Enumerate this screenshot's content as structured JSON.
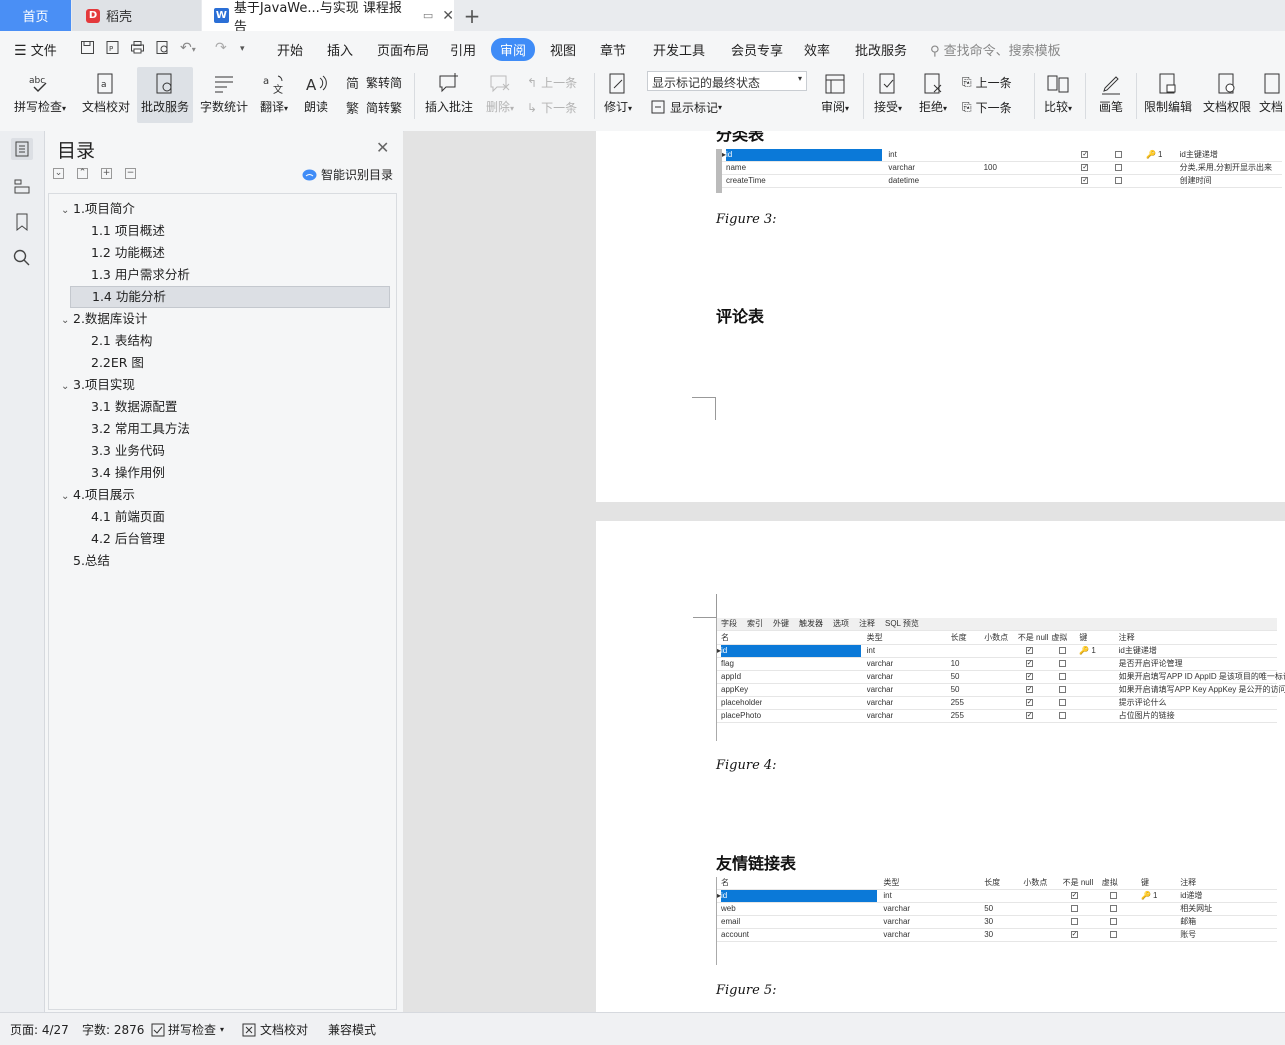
{
  "tabs": {
    "home": "首页",
    "daoke": "稻壳",
    "doc": "基于JavaWe...与实现 课程报告"
  },
  "menu": {
    "file": "文件",
    "items": [
      "开始",
      "插入",
      "页面布局",
      "引用",
      "审阅",
      "视图",
      "章节",
      "开发工具",
      "会员专享",
      "效率",
      "批改服务"
    ],
    "active": "审阅",
    "search_placeholder": "查找命令、搜索模板"
  },
  "ribbon": {
    "spell_check": "拼写检查",
    "doc_proof": "文档校对",
    "correction_service": "批改服务",
    "word_count": "字数统计",
    "translate": "翻译",
    "read_aloud": "朗读",
    "trad_to_simp": "繁转简",
    "simp_to_trad": "简转繁",
    "insert_comment": "插入批注",
    "delete": "删除",
    "prev_comment": "上一条",
    "next_comment": "下一条",
    "track_changes": "修订",
    "markup_state": "显示标记的最终状态",
    "show_markup": "显示标记",
    "review": "审阅",
    "accept": "接受",
    "reject": "拒绝",
    "prev_change": "上一条",
    "next_change": "下一条",
    "compare": "比较",
    "pen": "画笔",
    "restrict_edit": "限制编辑",
    "doc_permission": "文档权限",
    "doc_more": "文档"
  },
  "toc": {
    "title": "目录",
    "smart": "智能识别目录",
    "items": [
      {
        "label": "1.项目简介",
        "level": 1,
        "expanded": true
      },
      {
        "label": "1.1 项目概述",
        "level": 2
      },
      {
        "label": "1.2 功能概述",
        "level": 2
      },
      {
        "label": "1.3 用户需求分析",
        "level": 2
      },
      {
        "label": "1.4 功能分析",
        "level": 2,
        "selected": true
      },
      {
        "label": "2.数据库设计",
        "level": 1,
        "expanded": true
      },
      {
        "label": "2.1 表结构",
        "level": 2
      },
      {
        "label": "2.2ER 图",
        "level": 2
      },
      {
        "label": "3.项目实现",
        "level": 1,
        "expanded": true
      },
      {
        "label": "3.1 数据源配置",
        "level": 2
      },
      {
        "label": "3.2 常用工具方法",
        "level": 2
      },
      {
        "label": "3.3 业务代码",
        "level": 2
      },
      {
        "label": "3.4 操作用例",
        "level": 2
      },
      {
        "label": "4.项目展示",
        "level": 1,
        "expanded": true
      },
      {
        "label": "4.1 前端页面",
        "level": 2
      },
      {
        "label": "4.2 后台管理",
        "level": 2
      },
      {
        "label": "5.总结",
        "level": 1
      }
    ]
  },
  "document": {
    "heading_category": "分类表",
    "figure3": "Figure 3:",
    "heading_comment": "评论表",
    "figure4": "Figure 4:",
    "heading_links": "友情链接表",
    "figure5": "Figure 5:",
    "table_category": [
      {
        "name": "id",
        "type": "int",
        "len": "",
        "notnull": true,
        "virtual": false,
        "key": "1",
        "comment": "id主键递增"
      },
      {
        "name": "name",
        "type": "varchar",
        "len": "100",
        "notnull": true,
        "virtual": false,
        "key": "",
        "comment": "分类,采用,分割开显示出来"
      },
      {
        "name": "createTime",
        "type": "datetime",
        "len": "",
        "notnull": true,
        "virtual": false,
        "key": "",
        "comment": "创建时间"
      }
    ],
    "comment_tabs": [
      "字段",
      "索引",
      "外键",
      "触发器",
      "选项",
      "注释",
      "SQL 预览"
    ],
    "comment_headers": [
      "名",
      "类型",
      "长度",
      "小数点",
      "不是 null",
      "虚拟",
      "键",
      "注释"
    ],
    "table_comment": [
      {
        "name": "id",
        "type": "int",
        "len": "",
        "notnull": true,
        "virtual": false,
        "key": "1",
        "comment": "id主键递增"
      },
      {
        "name": "flag",
        "type": "varchar",
        "len": "10",
        "notnull": true,
        "virtual": false,
        "key": "",
        "comment": "是否开启评论管理"
      },
      {
        "name": "appId",
        "type": "varchar",
        "len": "50",
        "notnull": true,
        "virtual": false,
        "key": "",
        "comment": "如果开启填写APP ID AppID 是该项目的唯一标识符"
      },
      {
        "name": "appKey",
        "type": "varchar",
        "len": "50",
        "notnull": true,
        "virtual": false,
        "key": "",
        "comment": "如果开启请填写APP Key  AppKey 是公开的访问密钥"
      },
      {
        "name": "placeholder",
        "type": "varchar",
        "len": "255",
        "notnull": true,
        "virtual": false,
        "key": "",
        "comment": "提示评论什么"
      },
      {
        "name": "placePhoto",
        "type": "varchar",
        "len": "255",
        "notnull": true,
        "virtual": false,
        "key": "",
        "comment": "占位图片的链接"
      }
    ],
    "links_headers": [
      "名",
      "类型",
      "长度",
      "小数点",
      "不是 null",
      "虚拟",
      "键",
      "注释"
    ],
    "table_links": [
      {
        "name": "id",
        "type": "int",
        "len": "",
        "notnull": true,
        "virtual": false,
        "key": "1",
        "comment": "id递增"
      },
      {
        "name": "web",
        "type": "varchar",
        "len": "50",
        "notnull": false,
        "virtual": false,
        "key": "",
        "comment": "相关网址"
      },
      {
        "name": "email",
        "type": "varchar",
        "len": "30",
        "notnull": false,
        "virtual": false,
        "key": "",
        "comment": "邮箱"
      },
      {
        "name": "account",
        "type": "varchar",
        "len": "30",
        "notnull": true,
        "virtual": false,
        "key": "",
        "comment": "账号"
      }
    ]
  },
  "status": {
    "page": "页面: 4/27",
    "words": "字数: 2876",
    "spell_check": "拼写检查",
    "doc_proof": "文档校对",
    "compat_mode": "兼容模式"
  },
  "colors": {
    "accent": "#3f8cf7",
    "home_tab": "#4a8ff5",
    "row_highlight": "#0b79d8"
  }
}
